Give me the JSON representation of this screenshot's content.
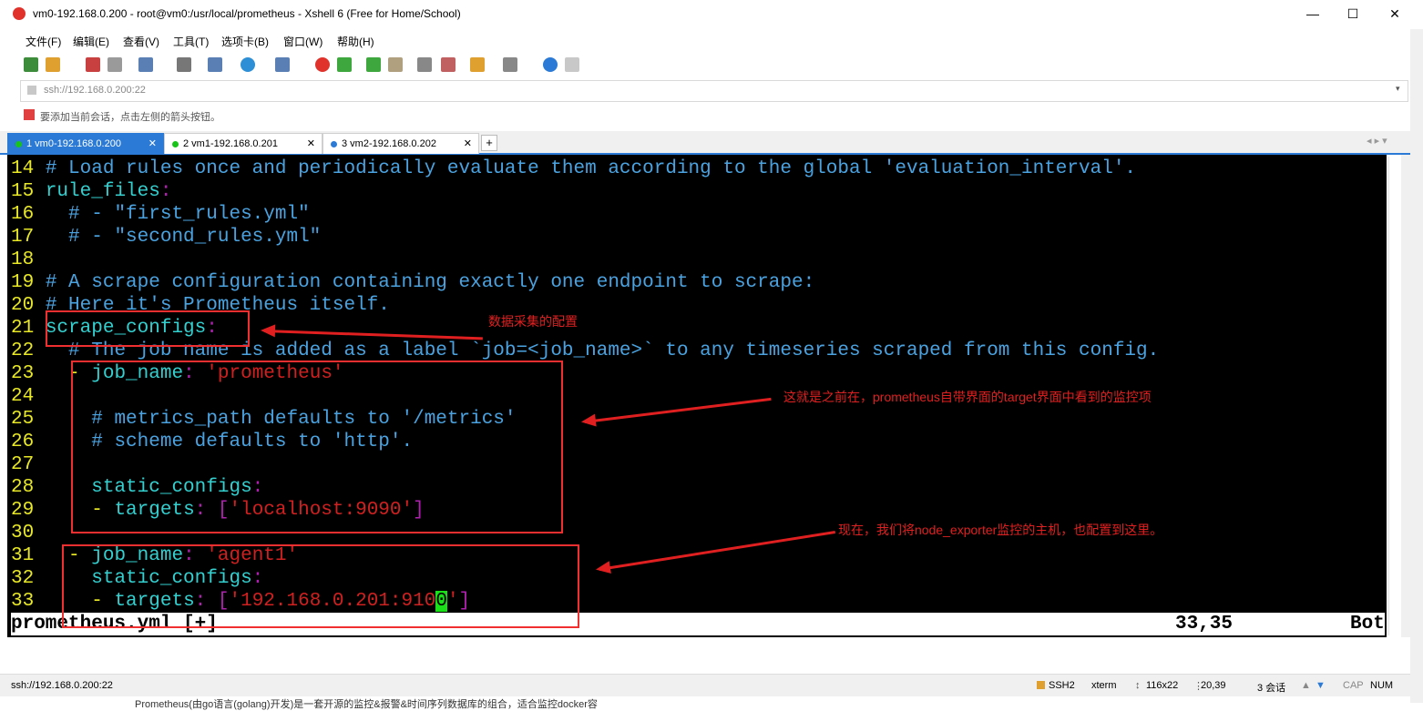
{
  "window": {
    "title": "vm0-192.168.0.200 - root@vm0:/usr/local/prometheus - Xshell 6 (Free for Home/School)",
    "minimize": "—",
    "maximize": "☐",
    "close": "✕"
  },
  "menu": [
    "文件(F)",
    "编辑(E)",
    "查看(V)",
    "工具(T)",
    "选项卡(B)",
    "窗口(W)",
    "帮助(H)"
  ],
  "address": {
    "value": "ssh://192.168.0.200:22",
    "hint": "要添加当前会话，点击左侧的箭头按钮。"
  },
  "tabs": [
    {
      "label": "1 vm0-192.168.0.200",
      "status_color": "#19c419",
      "close": "✕"
    },
    {
      "label": "2 vm1-192.168.0.201",
      "status_color": "#19c419",
      "close": "✕"
    },
    {
      "label": "3 vm2-192.168.0.202",
      "status_color": "#2b7ad6",
      "close": "✕"
    }
  ],
  "tab_add": "+",
  "tab_nav": "◂ ▸ ▾",
  "terminal": {
    "lines": [
      {
        "n": "14",
        "parts": [
          {
            "c": "cm",
            "t": "# Load rules once and periodically evaluate them according to the global 'evaluation_interval'."
          }
        ]
      },
      {
        "n": "15",
        "parts": [
          {
            "c": "key",
            "t": "rule_files"
          },
          {
            "c": "br",
            "t": ":"
          }
        ]
      },
      {
        "n": "16",
        "parts": [
          {
            "c": "cm",
            "t": "  # - \"first_rules.yml\""
          }
        ]
      },
      {
        "n": "17",
        "parts": [
          {
            "c": "cm",
            "t": "  # - \"second_rules.yml\""
          }
        ]
      },
      {
        "n": "18",
        "parts": []
      },
      {
        "n": "19",
        "parts": [
          {
            "c": "cm",
            "t": "# A scrape configuration containing exactly one endpoint to scrape:"
          }
        ]
      },
      {
        "n": "20",
        "parts": [
          {
            "c": "cm",
            "t": "# Here it's Prometheus itself."
          }
        ]
      },
      {
        "n": "21",
        "parts": [
          {
            "c": "key",
            "t": "scrape_configs"
          },
          {
            "c": "br",
            "t": ":"
          }
        ]
      },
      {
        "n": "22",
        "parts": [
          {
            "c": "cm",
            "t": "  # The job name is added as a label `job=<job_name>` to any timeseries scraped from this config."
          }
        ]
      },
      {
        "n": "23",
        "parts": [
          {
            "c": "dash",
            "t": "  - "
          },
          {
            "c": "key",
            "t": "job_name"
          },
          {
            "c": "br",
            "t": ": "
          },
          {
            "c": "str",
            "t": "'prometheus'"
          }
        ]
      },
      {
        "n": "24",
        "parts": []
      },
      {
        "n": "25",
        "parts": [
          {
            "c": "cm",
            "t": "    # metrics_path defaults to '/metrics'"
          }
        ]
      },
      {
        "n": "26",
        "parts": [
          {
            "c": "cm",
            "t": "    # scheme defaults to 'http'."
          }
        ]
      },
      {
        "n": "27",
        "parts": []
      },
      {
        "n": "28",
        "parts": [
          {
            "c": "key",
            "t": "    static_configs"
          },
          {
            "c": "br",
            "t": ":"
          }
        ]
      },
      {
        "n": "29",
        "parts": [
          {
            "c": "dash",
            "t": "    - "
          },
          {
            "c": "key",
            "t": "targets"
          },
          {
            "c": "br",
            "t": ": ["
          },
          {
            "c": "str",
            "t": "'localhost:9090'"
          },
          {
            "c": "br",
            "t": "]"
          }
        ]
      },
      {
        "n": "30",
        "parts": []
      },
      {
        "n": "31",
        "parts": [
          {
            "c": "dash",
            "t": "  - "
          },
          {
            "c": "key",
            "t": "job_name"
          },
          {
            "c": "br",
            "t": ": "
          },
          {
            "c": "str",
            "t": "'agent1'"
          }
        ]
      },
      {
        "n": "32",
        "parts": [
          {
            "c": "key",
            "t": "    static_configs"
          },
          {
            "c": "br",
            "t": ":"
          }
        ]
      },
      {
        "n": "33",
        "parts": [
          {
            "c": "dash",
            "t": "    - "
          },
          {
            "c": "key",
            "t": "targets"
          },
          {
            "c": "br",
            "t": ": ["
          },
          {
            "c": "str",
            "t": "'192.168.0.201:910"
          },
          {
            "c": "cursor",
            "t": "0"
          },
          {
            "c": "str",
            "t": "'"
          },
          {
            "c": "br",
            "t": "]"
          }
        ]
      }
    ],
    "status_file": "prometheus.yml [+]",
    "status_pos": "33,35",
    "status_scroll": "Bot"
  },
  "annotations": {
    "scrape_configs_note": "数据采集的配置",
    "prometheus_job_note": "这就是之前在，prometheus自带界面的target界面中看到的监控项",
    "agent1_note": "现在，我们将node_exporter监控的主机，也配置到这里。"
  },
  "statusbar": {
    "connection": "ssh://192.168.0.200:22",
    "protocol": "SSH2",
    "term": "xterm",
    "size": "116x22",
    "cursor": "20,39",
    "sessions": "3 会话",
    "caps": "CAP",
    "num": "NUM"
  },
  "bottom_text": "Prometheus(由go语言(golang)开发)是一套开源的监控&报警&时间序列数据库的组合，适合监控docker容"
}
